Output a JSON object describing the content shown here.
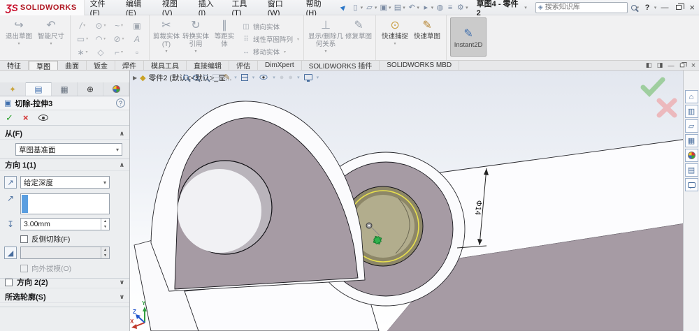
{
  "titlebar": {
    "logo_3s": "ƷS",
    "logo_text": "SOLIDWORKS",
    "menus": [
      "文件(F)",
      "编辑(E)",
      "视图(V)",
      "插入(I)",
      "工具(T)",
      "窗口(W)",
      "帮助(H)"
    ],
    "doc_switcher": "草图4 - 零件2",
    "search_placeholder": "搜索知识库",
    "help": "?"
  },
  "icons": {
    "new": "▯",
    "open": "▱",
    "save": "▣",
    "print": "▤",
    "undo": "↶",
    "select": "▸",
    "rebuild": "◍",
    "properties": "≡",
    "options_gear": "⚙",
    "home": "⌂",
    "design_library": "▥",
    "file_explorer": "▱",
    "view_palette": "▦",
    "custom_props": "▤",
    "dimxpert": "⊕",
    "part_tab": "✦",
    "property_tab": "▤",
    "config_tab": "▦"
  },
  "ribbon": {
    "exit_sketch": "退出草图",
    "smart_dim": "智能尺寸",
    "glyph_rows": [
      [
        "/",
        "⊙",
        "~",
        "▣"
      ],
      [
        "▭",
        "◠",
        "⊘",
        "A"
      ],
      [
        "∗",
        "◇",
        "⌐",
        "▫"
      ]
    ],
    "trim": "剪裁实体(T)",
    "convert": "转换实体引用",
    "offset": "等距实体",
    "mirror": "镜向实体",
    "pattern": "线性草图阵列",
    "move": "移动实体",
    "relations": "显示/删除几何关系",
    "repair": "修复草图",
    "snap": "快速捕捉",
    "quick_sketch": "快速草图",
    "instant2d": "Instant2D"
  },
  "tabs": {
    "items": [
      "特征",
      "草图",
      "曲面",
      "钣金",
      "焊件",
      "模具工具",
      "直接编辑",
      "评估",
      "DimXpert",
      "SOLIDWORKS 插件",
      "SOLIDWORKS MBD"
    ],
    "active": "草图"
  },
  "docbar": {
    "tree_label": "零件2 (默认<<默认>_显..."
  },
  "panel": {
    "title": "切除-拉伸3",
    "help": "?",
    "from": {
      "label": "从(F)",
      "combo_value": "草图基准面"
    },
    "dir1": {
      "label": "方向 1(1)",
      "end_condition": "给定深度",
      "depth_value": "3.00mm",
      "flip_side": "反侧切除(F)",
      "draft_outward": "向外拔模(O)"
    },
    "dir2": {
      "label": "方向 2(2)"
    },
    "contours": {
      "label": "所选轮廓(S)"
    }
  },
  "viewport": {
    "dimension_label": "Φ14",
    "axis": {
      "x": "X",
      "y": "Y",
      "z": "Z"
    }
  },
  "colors": {
    "part_mauve": "#a69ba4",
    "pocket_olive": "#8d8768",
    "pocket_khaki": "#b2ad8d",
    "highlight_yellow": "#e8e04e",
    "marker_green": "#2fb14c",
    "confirm_green": "#9fce9f",
    "cancel_pink": "#ecb9bd",
    "logo_red": "#c8102e"
  }
}
